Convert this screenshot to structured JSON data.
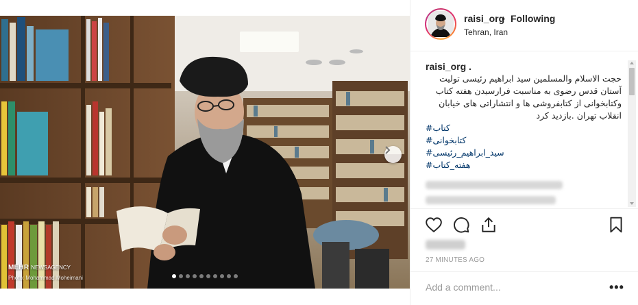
{
  "post": {
    "username": "raisi_org",
    "separator": "•",
    "follow_status": "Following",
    "location": "Tehran, Iran",
    "caption_user": "raisi_org .",
    "caption_text": "حجت الاسلام والمسلمین سید ابراهیم رئیسی تولیت آستان قدس رضوی به مناسبت فرارسیدن هفته کتاب وکتابخوانی از کتابفروشی ها و انتشاراتی های خیابان انقلاب تهران .بازدید کرد",
    "hashtags": [
      "کتاب#",
      "کتابخوانی#",
      "سید_ابراهیم_رئیسی#",
      "هفته_کتاب#"
    ],
    "time_ago": "27 MINUTES AGO",
    "comment_placeholder": "Add a comment...",
    "more_label": "•••"
  },
  "media": {
    "watermark_agency": "MEHR",
    "watermark_agency_small": "NEWSAGENCY",
    "watermark_photographer": "Photo: Mohammad Moheimani",
    "carousel_count": 10,
    "carousel_active_index": 0
  },
  "icons": {
    "like": "heart-icon",
    "comment": "comment-bubble-icon",
    "share": "share-icon",
    "save": "bookmark-icon",
    "next": "chevron-right-icon"
  },
  "colors": {
    "hashtag": "#003569",
    "text": "#262626",
    "muted": "#999999",
    "story_ring": "#e1306c"
  }
}
